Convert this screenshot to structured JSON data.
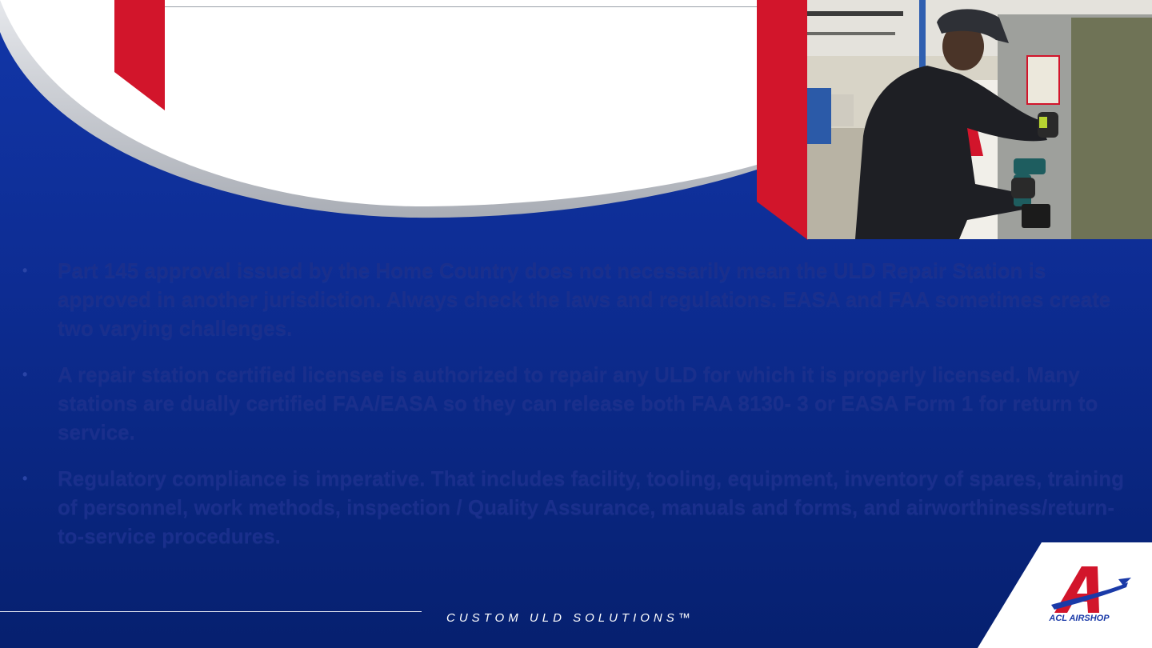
{
  "bullets": [
    "Part 145 approval issued by the Home Country does not necessarily mean the ULD Repair Station is approved in another jurisdiction. Always check the laws and regulations. EASA and FAA sometimes create two varying challenges.",
    "A repair station certified licensee is authorized to repair any ULD for which it is properly licensed.  Many stations are dually certified FAA/EASA so they can release both FAA 8130- 3 or EASA Form 1 for return to service.",
    "Regulatory compliance is imperative. That includes facility, tooling, equipment, inventory of spares, training of personnel, work methods, inspection / Quality Assurance, manuals and forms, and airworthiness/return-to-service procedures."
  ],
  "bullet_marker": "•",
  "footer": {
    "tagline": "CUSTOM ULD SOLUTIONS™",
    "logo_text": "ACL AIRSHOP"
  },
  "colors": {
    "background_blue": "#0d2c92",
    "accent_red": "#d2152b",
    "text_blue": "#1a2f8c"
  },
  "icons": {
    "logo": "acl-airshop-logo-icon"
  }
}
